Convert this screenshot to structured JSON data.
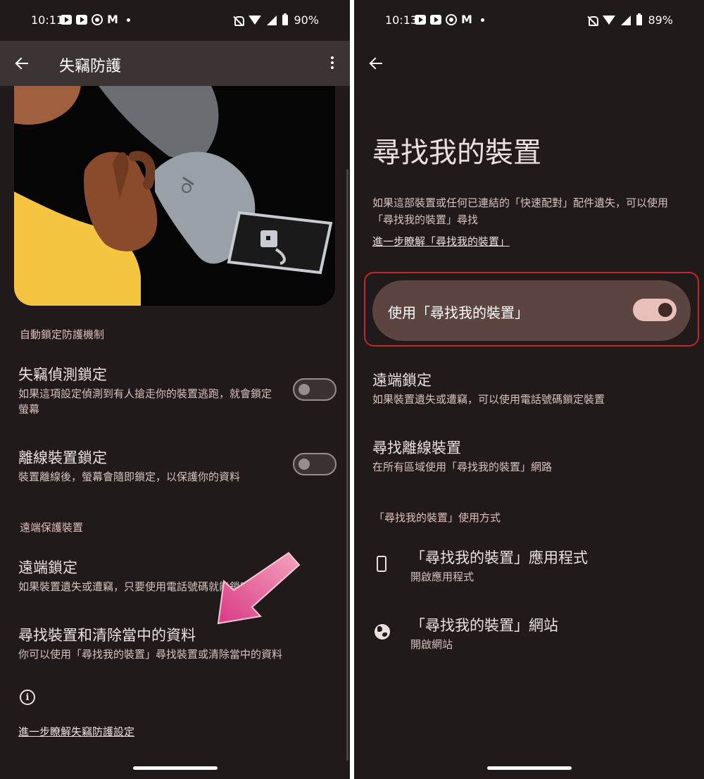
{
  "colors": {
    "background": "#201a1a",
    "accent": "#e8bfb9",
    "section_header": "#e0bfbc",
    "highlight_outline": "#c0282c",
    "arrow": "#d94a8c"
  },
  "left": {
    "status": {
      "time": "10:11",
      "battery": "90%"
    },
    "appbar": {
      "title": "失竊防護"
    },
    "section_auto": "自動鎖定防護機制",
    "theft_lock": {
      "title": "失竊偵測鎖定",
      "subtitle": "如果這項設定偵測到有人搶走你的裝置逃跑，就會鎖定螢幕",
      "enabled": false
    },
    "offline_lock": {
      "title": "離線裝置鎖定",
      "subtitle": "裝置離線後，螢幕會隨即鎖定，以保護你的資料",
      "enabled": false
    },
    "section_remote": "遠端保護裝置",
    "remote_lock": {
      "title": "遠端鎖定",
      "subtitle": "如果裝置遺失或遭竊，只要使用電話號碼就能鎖定螢幕"
    },
    "find_erase": {
      "title": "尋找裝置和清除當中的資料",
      "subtitle": "你可以使用「尋找我的裝置」尋找裝置或清除當中的資料"
    },
    "learn_more": "進一步瞭解失竊防護設定"
  },
  "right": {
    "status": {
      "time": "10:13",
      "battery": "89%"
    },
    "title": "尋找我的裝置",
    "description": "如果這部裝置或任何已連結的「快速配對」配件遺失，可以使用「尋找我的裝置」尋找",
    "learn_more": "進一步瞭解「尋找我的裝置」",
    "main_toggle": {
      "label": "使用「尋找我的裝置」",
      "enabled": true
    },
    "remote_lock": {
      "title": "遠端鎖定",
      "subtitle": "如果裝置遺失或遭竊，可以使用電話號碼鎖定裝置"
    },
    "offline_find": {
      "title": "尋找離線裝置",
      "subtitle": "在所有區域使用「尋找我的裝置」網路"
    },
    "section_usage": "「尋找我的裝置」使用方式",
    "app_item": {
      "title": "「尋找我的裝置」應用程式",
      "subtitle": "開啟應用程式",
      "icon": "phone-icon"
    },
    "web_item": {
      "title": "「尋找我的裝置」網站",
      "subtitle": "開啟網站",
      "icon": "globe-icon"
    }
  }
}
